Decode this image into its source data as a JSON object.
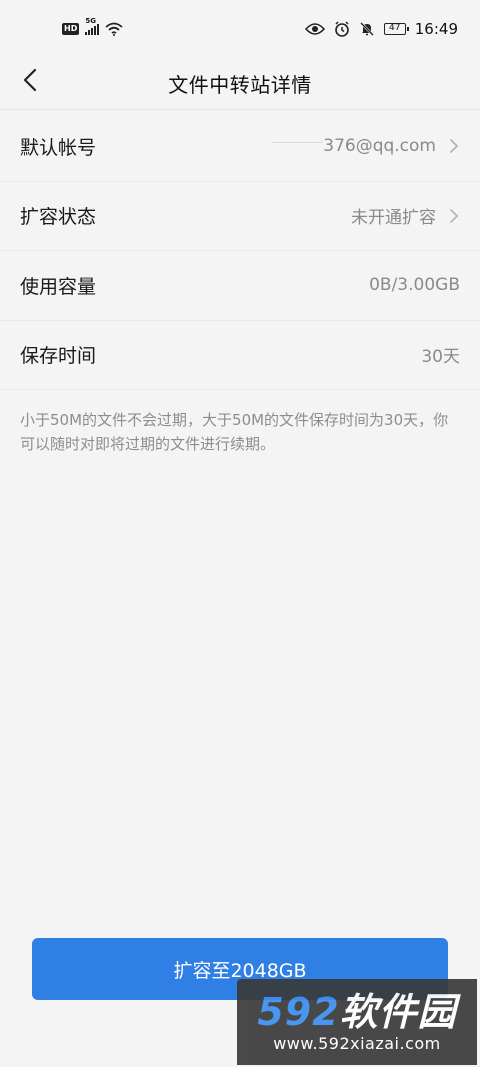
{
  "status_bar": {
    "hd": "HD",
    "network": "5G",
    "battery": "47",
    "time": "16:49",
    "icons": [
      "hd-icon",
      "signal-icon",
      "wifi-icon",
      "eye-icon",
      "alarm-icon",
      "mute-icon",
      "battery-icon"
    ]
  },
  "nav": {
    "title": "文件中转站详情"
  },
  "rows": [
    {
      "label": "默认帐号",
      "value": "376@qq.com"
    },
    {
      "label": "扩容状态",
      "value": "未开通扩容"
    },
    {
      "label": "使用容量",
      "value": "0B/3.00GB"
    },
    {
      "label": "保存时间",
      "value": "30天"
    }
  ],
  "note": "小于50M的文件不会过期，大于50M的文件保存时间为30天，你可以随时对即将过期的文件进行续期。",
  "button": {
    "label": "扩容至2048GB"
  },
  "watermark": {
    "brand_num": "592",
    "brand_text": "软件园",
    "url": "www.592xiazai.com"
  },
  "colors": {
    "background": "#f4f4f4",
    "accent": "#2f7fe4",
    "secondary_text": "#8a8a8a"
  }
}
